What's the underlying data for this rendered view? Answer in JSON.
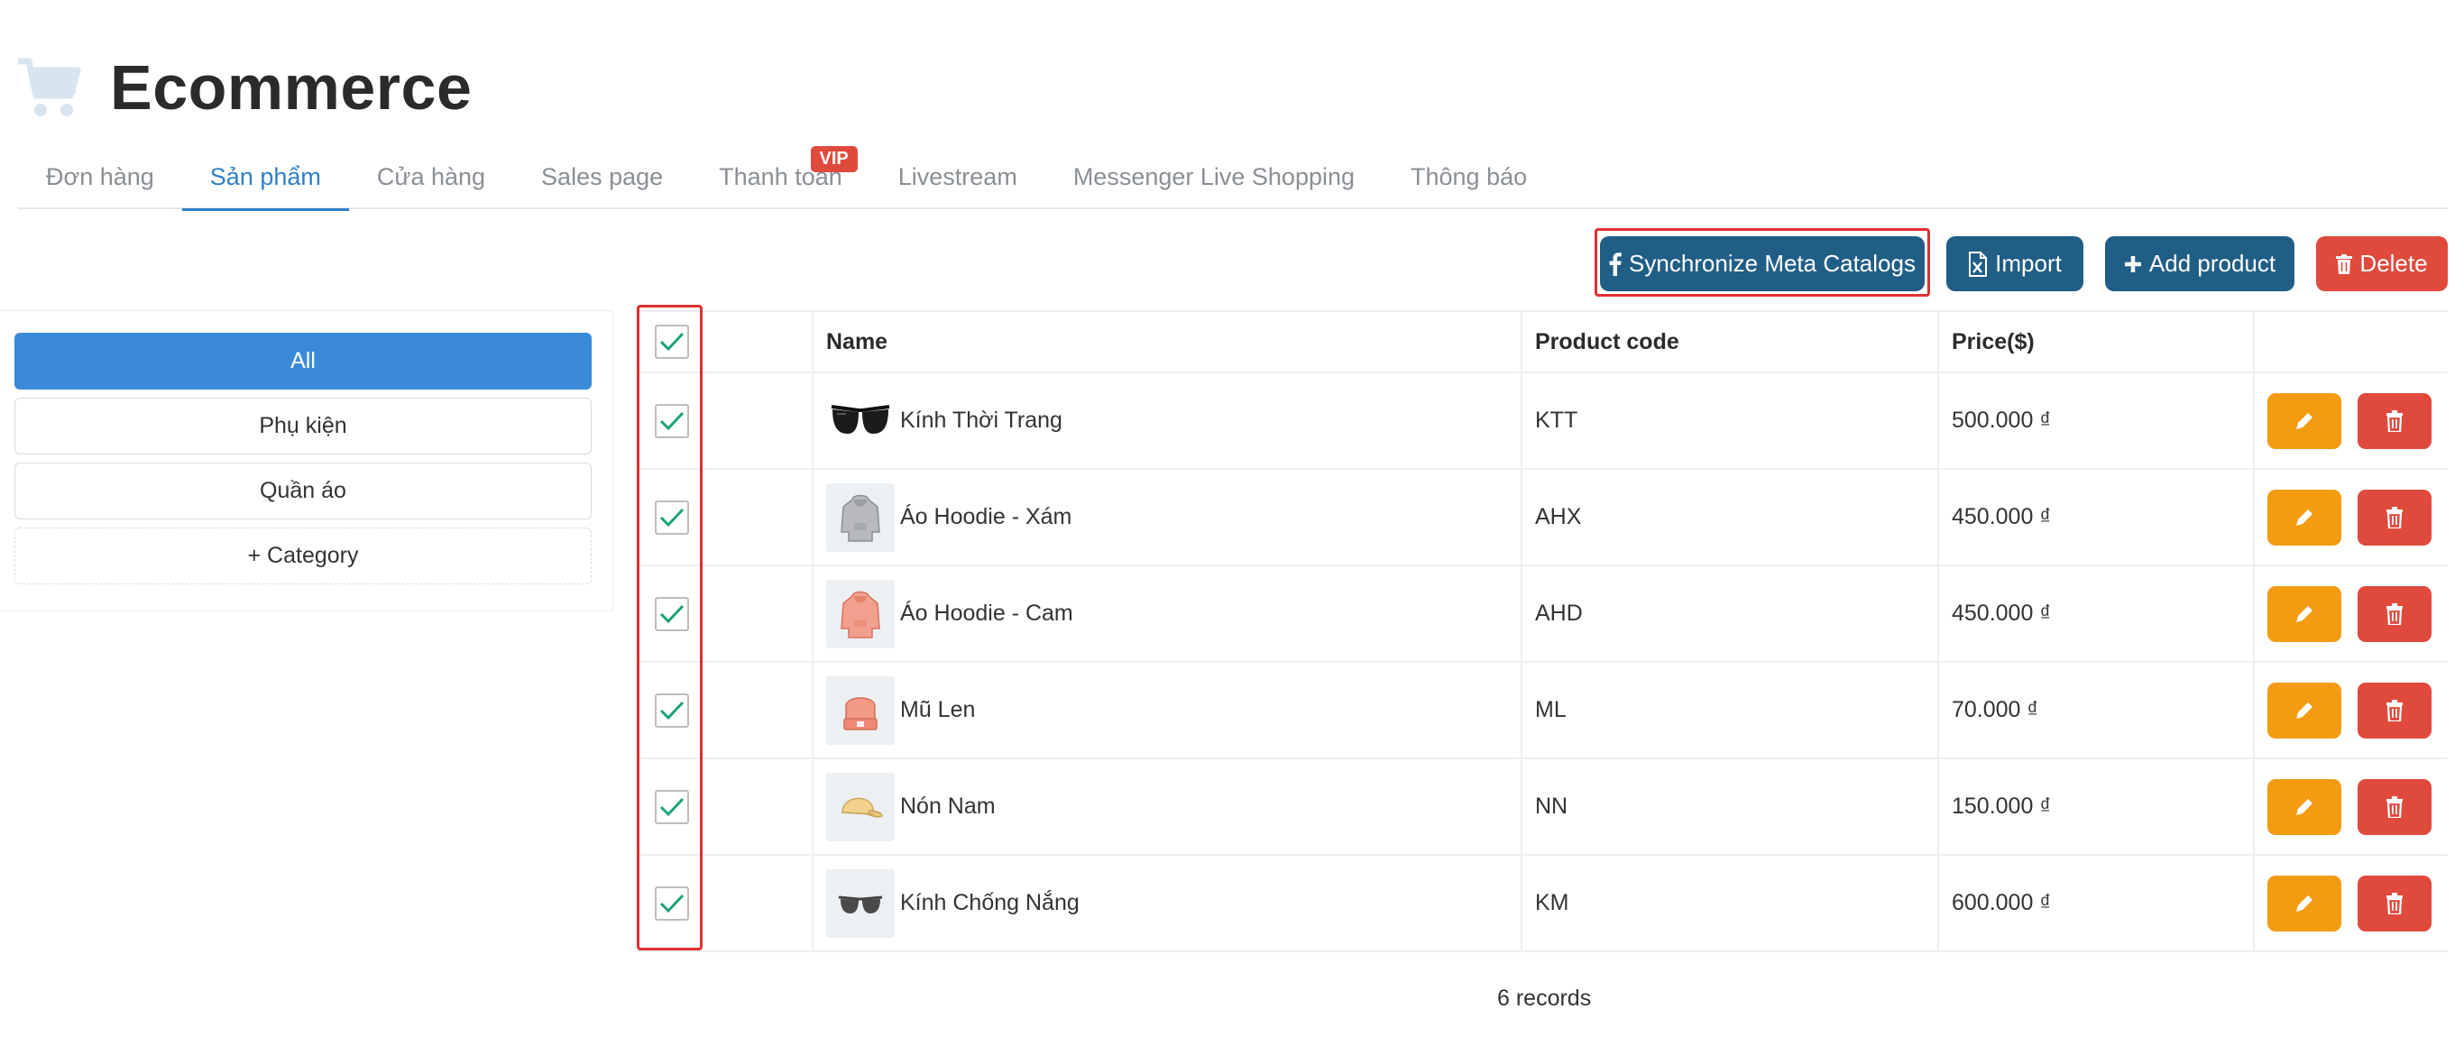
{
  "app": {
    "title": "Ecommerce"
  },
  "tabs": [
    {
      "label": "Đơn hàng",
      "active": false
    },
    {
      "label": "Sản phẩm",
      "active": true
    },
    {
      "label": "Cửa hàng",
      "active": false
    },
    {
      "label": "Sales page",
      "active": false
    },
    {
      "label": "Thanh toán",
      "active": false,
      "badge": "VIP"
    },
    {
      "label": "Livestream",
      "active": false
    },
    {
      "label": "Messenger Live Shopping",
      "active": false
    },
    {
      "label": "Thông báo",
      "active": false
    }
  ],
  "toolbar": {
    "sync_label": "Synchronize Meta Catalogs",
    "import_label": "Import",
    "add_label": "Add product",
    "delete_label": "Delete"
  },
  "categories": [
    {
      "label": "All",
      "active": true
    },
    {
      "label": "Phụ kiện",
      "active": false
    },
    {
      "label": "Quần áo",
      "active": false
    }
  ],
  "add_category_label": "+ Category",
  "table": {
    "headers": {
      "name": "Name",
      "code": "Product code",
      "price": "Price($)"
    },
    "rows": [
      {
        "name": "Kính Thời Trang",
        "code": "KTT",
        "price": "500.000 ₫",
        "image": "sunglasses-image",
        "checked": true
      },
      {
        "name": "Áo Hoodie - Xám",
        "code": "AHX",
        "price": "450.000 ₫",
        "image": "grey-hoodie-image",
        "checked": true
      },
      {
        "name": "Áo Hoodie - Cam",
        "code": "AHD",
        "price": "450.000 ₫",
        "image": "orange-hoodie-image",
        "checked": true
      },
      {
        "name": "Mũ Len",
        "code": "ML",
        "price": "70.000 ₫",
        "image": "beanie-image",
        "checked": true
      },
      {
        "name": "Nón Nam",
        "code": "NN",
        "price": "150.000 ₫",
        "image": "cap-image",
        "checked": true
      },
      {
        "name": "Kính Chống Nắng",
        "code": "KM",
        "price": "600.000 ₫",
        "image": "sunglasses-small-image",
        "checked": true
      }
    ]
  },
  "footer": {
    "records": "6 records"
  },
  "colors": {
    "primary": "#215e86",
    "active_tab": "#2f80c9",
    "danger": "#e04a3d",
    "warning": "#f39c12",
    "check": "#1aa37a",
    "highlight": "#e0302f"
  }
}
